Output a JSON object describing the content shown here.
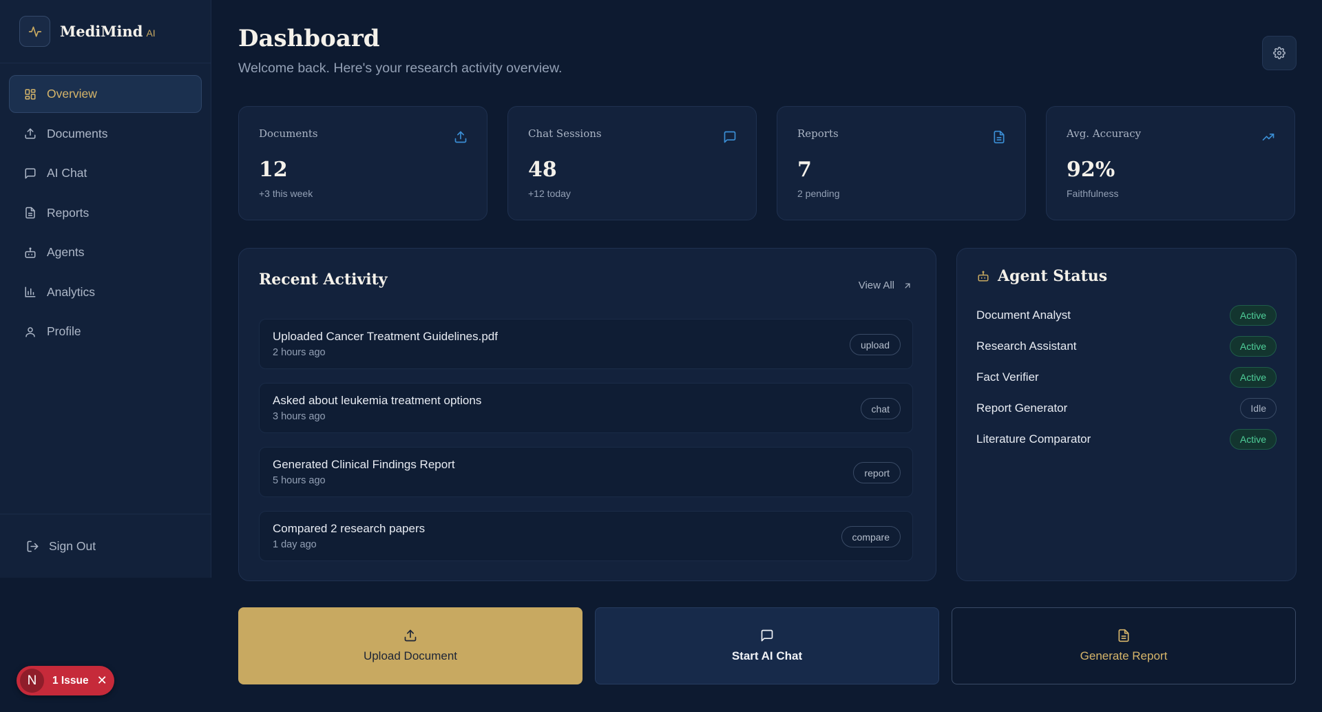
{
  "brand": {
    "name": "MediMind",
    "suffix": "AI"
  },
  "nav": {
    "items": [
      {
        "label": "Overview"
      },
      {
        "label": "Documents"
      },
      {
        "label": "AI Chat"
      },
      {
        "label": "Reports"
      },
      {
        "label": "Agents"
      },
      {
        "label": "Analytics"
      },
      {
        "label": "Profile"
      }
    ],
    "signout": "Sign Out"
  },
  "issue": {
    "initial": "N",
    "label": "1 Issue",
    "close": "✕"
  },
  "header": {
    "title": "Dashboard",
    "subtitle": "Welcome back. Here's your research activity overview."
  },
  "stats": [
    {
      "label": "Documents",
      "value": "12",
      "sub": "+3 this week",
      "icon": "upload-icon"
    },
    {
      "label": "Chat Sessions",
      "value": "48",
      "sub": "+12 today",
      "icon": "chat-icon"
    },
    {
      "label": "Reports",
      "value": "7",
      "sub": "2 pending",
      "icon": "document-icon"
    },
    {
      "label": "Avg. Accuracy",
      "value": "92%",
      "sub": "Faithfulness",
      "icon": "trending-up-icon"
    }
  ],
  "activity": {
    "title": "Recent Activity",
    "view_all": "View All",
    "items": [
      {
        "title": "Uploaded Cancer Treatment Guidelines.pdf",
        "time": "2 hours ago",
        "tag": "upload"
      },
      {
        "title": "Asked about leukemia treatment options",
        "time": "3 hours ago",
        "tag": "chat"
      },
      {
        "title": "Generated Clinical Findings Report",
        "time": "5 hours ago",
        "tag": "report"
      },
      {
        "title": "Compared 2 research papers",
        "time": "1 day ago",
        "tag": "compare"
      }
    ]
  },
  "agents": {
    "title": "Agent Status",
    "items": [
      {
        "name": "Document Analyst",
        "status": "Active"
      },
      {
        "name": "Research Assistant",
        "status": "Active"
      },
      {
        "name": "Fact Verifier",
        "status": "Active"
      },
      {
        "name": "Report Generator",
        "status": "Idle"
      },
      {
        "name": "Literature Comparator",
        "status": "Active"
      }
    ]
  },
  "actions": {
    "upload": "Upload Document",
    "chat": "Start AI Chat",
    "report": "Generate Report"
  },
  "colors": {
    "accent": "#c8a961",
    "background": "#0d1a30",
    "active_status": "#4fd09a",
    "icon_blue": "#3b8fd6"
  }
}
